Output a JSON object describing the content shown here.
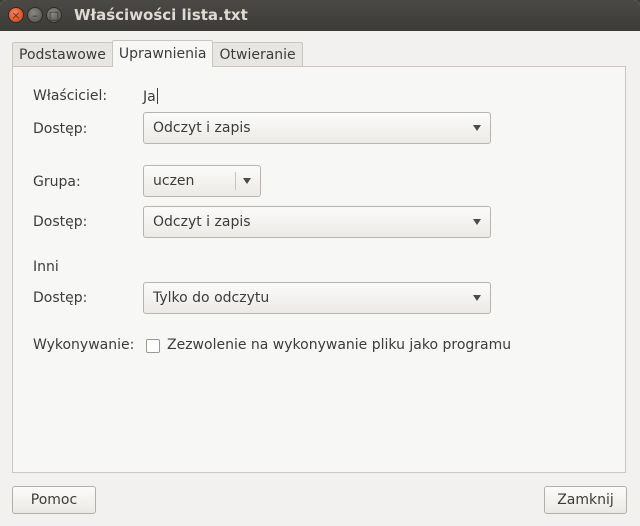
{
  "window": {
    "title": "Właściwości lista.txt",
    "close_glyph": "×",
    "min_glyph": "–",
    "max_glyph": "□"
  },
  "tabs": [
    {
      "label": "Podstawowe",
      "active": false
    },
    {
      "label": "Uprawnienia",
      "active": true
    },
    {
      "label": "Otwieranie",
      "active": false
    }
  ],
  "owner": {
    "label": "Właściciel:",
    "value": "Ja",
    "access_label": "Dostęp:",
    "access_value": "Odczyt i zapis"
  },
  "group": {
    "label": "Grupa:",
    "value": "uczen",
    "access_label": "Dostęp:",
    "access_value": "Odczyt i zapis"
  },
  "others": {
    "label": "Inni",
    "access_label": "Dostęp:",
    "access_value": "Tylko do odczytu"
  },
  "execute": {
    "label": "Wykonywanie:",
    "checkbox_label": "Zezwolenie na wykonywanie pliku jako programu",
    "checked": false
  },
  "buttons": {
    "help": "Pomoc",
    "close": "Zamknij"
  }
}
